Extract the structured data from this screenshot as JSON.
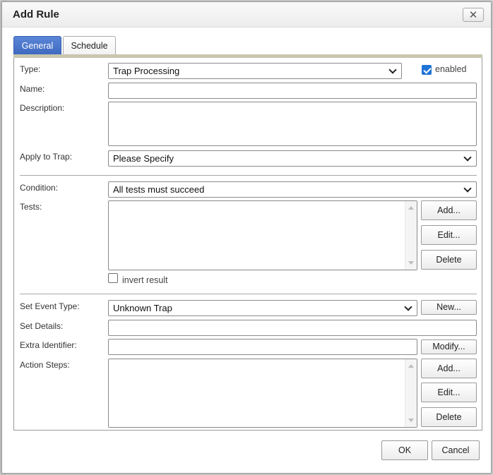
{
  "dialog": {
    "title": "Add Rule",
    "close_glyph": "✕"
  },
  "tabs": [
    {
      "label": "General",
      "active": true
    },
    {
      "label": "Schedule",
      "active": false
    }
  ],
  "form": {
    "type_label": "Type:",
    "type_value": "Trap Processing",
    "enabled_label": "enabled",
    "enabled_checked": true,
    "name_label": "Name:",
    "name_value": "",
    "description_label": "Description:",
    "description_value": "",
    "apply_label": "Apply to Trap:",
    "apply_value": "Please Specify",
    "condition_label": "Condition:",
    "condition_value": "All tests must succeed",
    "tests_label": "Tests:",
    "tests_add": "Add...",
    "tests_edit": "Edit...",
    "tests_delete": "Delete",
    "invert_label": "invert result",
    "invert_checked": false,
    "event_type_label": "Set Event Type:",
    "event_type_value": "Unknown Trap",
    "event_type_new": "New...",
    "details_label": "Set Details:",
    "details_value": "",
    "extra_id_label": "Extra Identifier:",
    "extra_id_value": "",
    "extra_id_modify": "Modify...",
    "action_steps_label": "Action Steps:",
    "actions_add": "Add...",
    "actions_edit": "Edit...",
    "actions_delete": "Delete"
  },
  "footer": {
    "ok": "OK",
    "cancel": "Cancel"
  },
  "colors": {
    "active_tab": "#3d68c0",
    "checkbox": "#1f74d6"
  }
}
